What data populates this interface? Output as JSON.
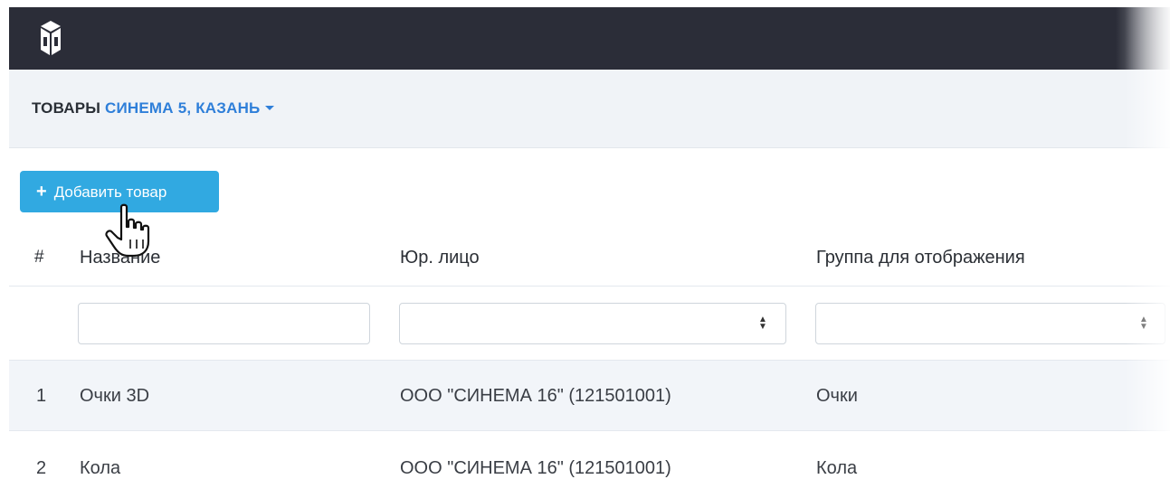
{
  "header": {
    "logo_icon": "cube-logo-icon"
  },
  "breadcrumb": {
    "section": "ТОВАРЫ",
    "location": "СИНЕМА 5, КАЗАНЬ"
  },
  "toolbar": {
    "add_label": "Добавить товар",
    "add_icon": "plus-icon"
  },
  "table": {
    "columns": [
      "#",
      "Название",
      "Юр. лицо",
      "Группа для отображения"
    ],
    "filters": {
      "name_value": "",
      "legal_value": "",
      "group_value": ""
    },
    "rows": [
      {
        "num": "1",
        "name": "Очки 3D",
        "legal": "ООО \"СИНЕМА 16\" (121501001)",
        "group": "Очки"
      },
      {
        "num": "2",
        "name": "Кола",
        "legal": "ООО \"СИНЕМА 16\" (121501001)",
        "group": "Кола"
      }
    ]
  },
  "colors": {
    "topbar": "#2b2d38",
    "accent": "#31a9e1",
    "link": "#2f7fd9"
  }
}
